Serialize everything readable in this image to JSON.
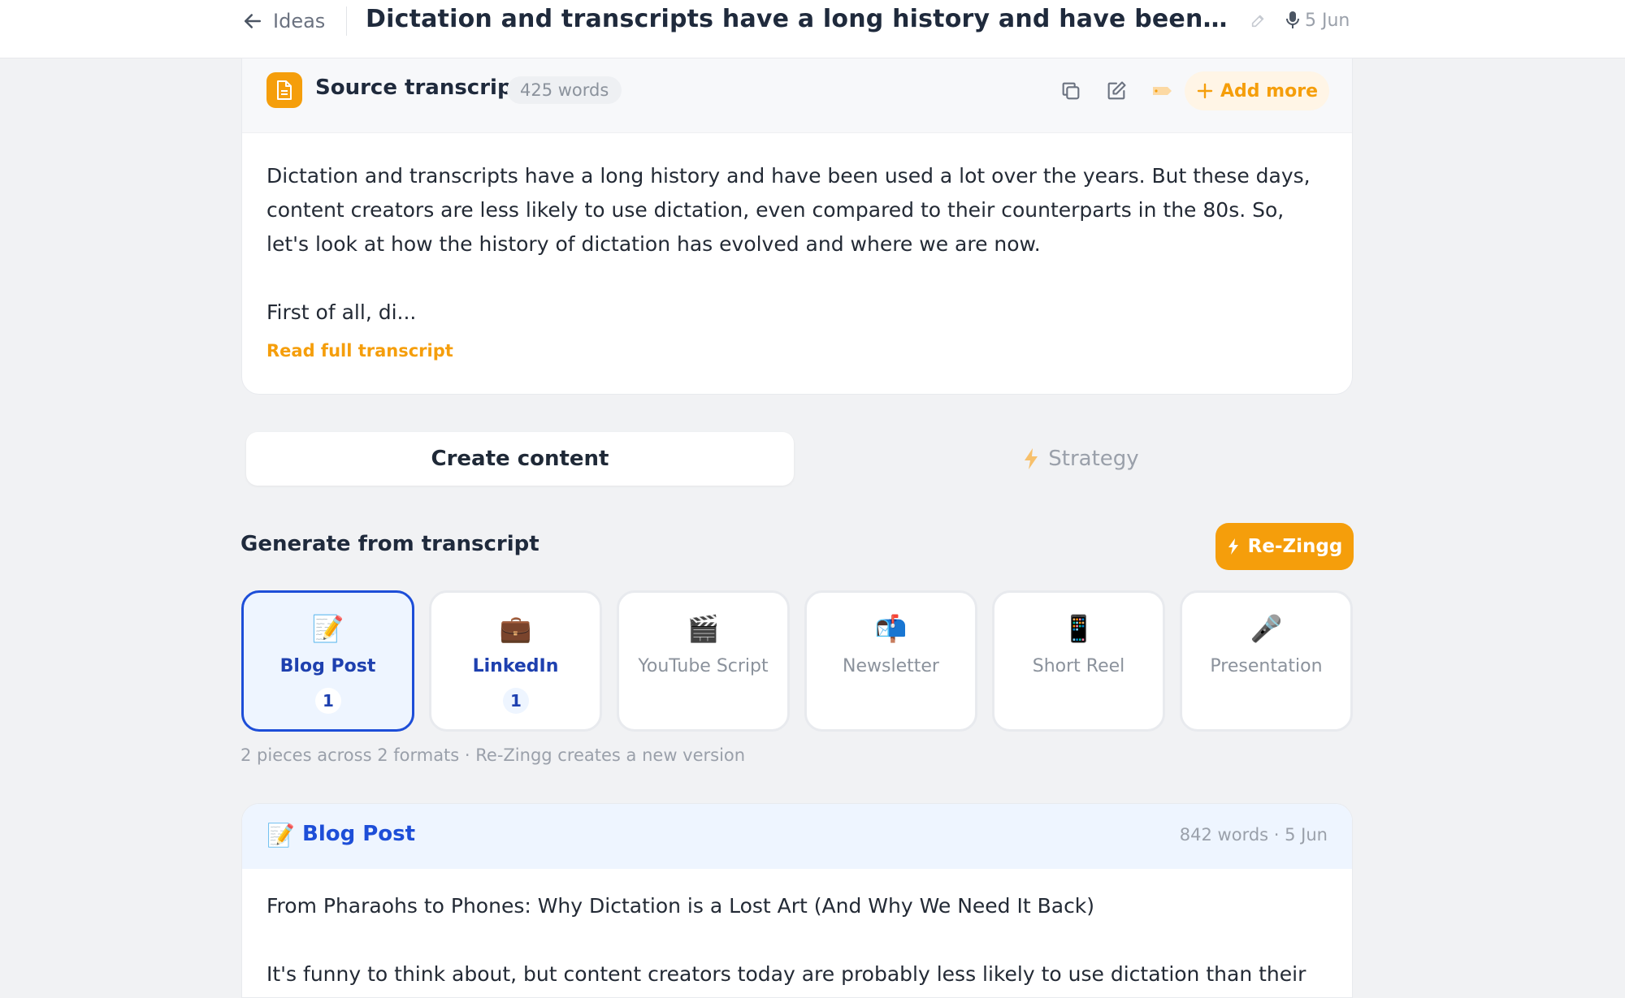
{
  "header": {
    "back_label": "Ideas",
    "title": "Dictation and transcripts have a long history and have been used a lot o...",
    "date": "5 Jun",
    "icons": [
      "arrow-left-icon",
      "pencil-icon",
      "microphone-icon"
    ]
  },
  "source": {
    "title": "Source transcript",
    "word_count": "425 words",
    "add_more_label": "Add more",
    "paragraphs": [
      "Dictation and transcripts have a long history and have been used a lot over the years. But these days, content creators are less likely to use dictation, even compared to their counterparts in the 80s. So, let's look at how the history of dictation has evolved and where we are now.",
      "First of all, di..."
    ],
    "read_full_label": "Read full transcript",
    "icons": [
      "document-icon",
      "copy-icon",
      "edit-icon",
      "tag-icon",
      "plus-icon"
    ]
  },
  "tabs": {
    "create": "Create content",
    "strategy": "Strategy"
  },
  "generate": {
    "title": "Generate from transcript",
    "rezingg_label": "Re-Zingg",
    "formats": [
      {
        "emoji": "📝",
        "label": "Blog Post",
        "count": "1"
      },
      {
        "emoji": "💼",
        "label": "LinkedIn",
        "count": "1"
      },
      {
        "emoji": "🎬",
        "label": "YouTube Script"
      },
      {
        "emoji": "📬",
        "label": "Newsletter"
      },
      {
        "emoji": "📱",
        "label": "Short Reel"
      },
      {
        "emoji": "🎤",
        "label": "Presentation"
      }
    ],
    "note": "2 pieces across 2 formats · Re-Zingg creates a new version"
  },
  "post": {
    "emoji": "📝",
    "title": "Blog Post",
    "meta": "842 words · 5 Jun",
    "headline": "From Pharaohs to Phones: Why Dictation is a Lost Art (And Why We Need It Back)",
    "first_line": "It's funny to think about, but content creators today are probably less likely to use dictation than their"
  },
  "colors": {
    "accent": "#f59e0b",
    "primary_blue": "#1d4ed8",
    "background": "#f1f2f4"
  }
}
